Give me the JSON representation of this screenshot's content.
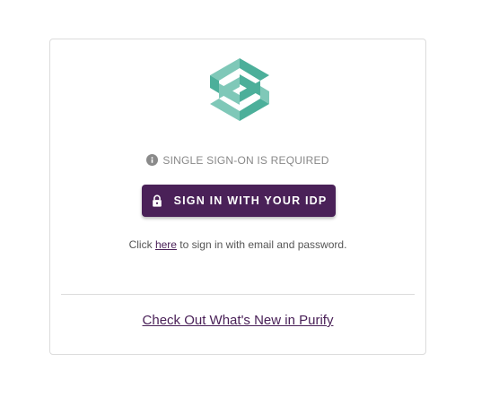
{
  "logo": {
    "icon": "purify-logo-icon",
    "colors": {
      "primary": "#4caf9a",
      "light": "#7fc8b8"
    }
  },
  "notice": {
    "icon": "info-icon",
    "text": "SINGLE SIGN-ON IS REQUIRED"
  },
  "sso_button": {
    "icon": "lock-icon",
    "label": "SIGN IN WITH YOUR IDP",
    "color": "#4a2158"
  },
  "alt_signin": {
    "prefix": "Click ",
    "link": "here",
    "suffix": " to sign in with email and password."
  },
  "footer": {
    "link": "Check Out What's New in Purify"
  }
}
